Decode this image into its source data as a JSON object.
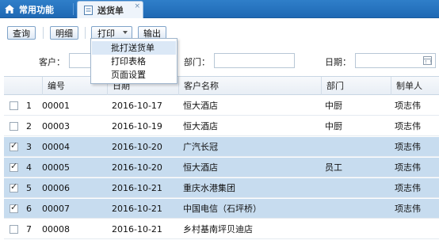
{
  "tabs": [
    {
      "label": "常用功能",
      "icon": "home-icon"
    },
    {
      "label": "送货单",
      "icon": "document-icon",
      "close": "×"
    }
  ],
  "toolbar": {
    "search_label": "查询",
    "detail_label": "明细",
    "print_label": "打印",
    "export_label": "输出"
  },
  "print_menu": {
    "items": [
      "批打送货单",
      "打印表格",
      "页面设置"
    ]
  },
  "filter": {
    "customer_label": "客户：",
    "dept_label": "部门：",
    "date_label": "日期："
  },
  "table": {
    "columns": [
      "编号",
      "日期",
      "客户名称",
      "部门",
      "制单人"
    ],
    "rows": [
      {
        "n": "1",
        "id": "00001",
        "date": "2016-10-17",
        "customer": "恒大酒店",
        "dept": "中厨",
        "maker": "项志伟",
        "checked": false
      },
      {
        "n": "2",
        "id": "00003",
        "date": "2016-10-19",
        "customer": "恒大酒店",
        "dept": "中厨",
        "maker": "项志伟",
        "checked": false
      },
      {
        "n": "3",
        "id": "00004",
        "date": "2016-10-20",
        "customer": "广汽长冠",
        "dept": "",
        "maker": "项志伟",
        "checked": true
      },
      {
        "n": "4",
        "id": "00005",
        "date": "2016-10-20",
        "customer": "恒大酒店",
        "dept": "员工",
        "maker": "项志伟",
        "checked": true
      },
      {
        "n": "5",
        "id": "00006",
        "date": "2016-10-21",
        "customer": "重庆水港集团",
        "dept": "",
        "maker": "项志伟",
        "checked": true
      },
      {
        "n": "6",
        "id": "00007",
        "date": "2016-10-21",
        "customer": "中国电信（石坪桥）",
        "dept": "",
        "maker": "项志伟",
        "checked": true
      },
      {
        "n": "7",
        "id": "00008",
        "date": "2016-10-21",
        "customer": "乡村基南坪贝迪店",
        "dept": "",
        "maker": "",
        "checked": false
      }
    ]
  },
  "colors": {
    "tabbar": "#2f7fc9",
    "selected_row": "#c7dcef"
  }
}
